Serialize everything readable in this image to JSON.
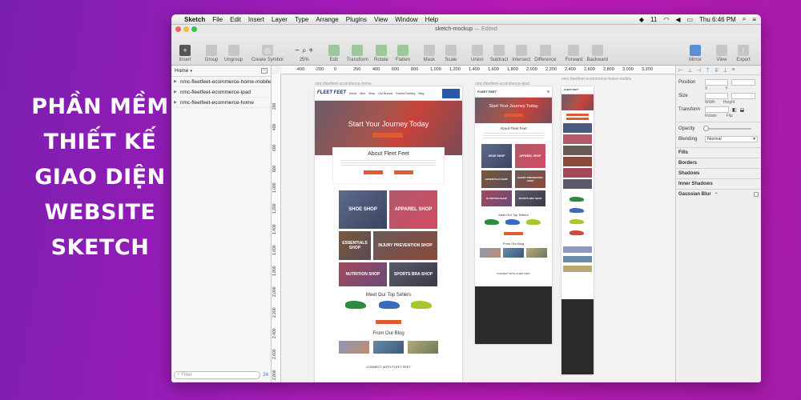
{
  "headline": [
    "PHẦN MỀM",
    "THIẾT KẾ",
    "GIAO DIỆN",
    "WEBSITE",
    "SKETCH"
  ],
  "menubar": {
    "app": "Sketch",
    "items": [
      "File",
      "Edit",
      "Insert",
      "Layer",
      "Type",
      "Arrange",
      "Plugins",
      "View",
      "Window",
      "Help"
    ],
    "status_count": "11",
    "clock": "Thu 6:46 PM"
  },
  "window": {
    "doc_title": "sketch-mockup",
    "edited": "— Edited"
  },
  "toolbar": {
    "left": [
      "Insert",
      "Group",
      "Ungroup",
      "Create Symbol"
    ],
    "zoom": "25%",
    "middle": [
      "Edit",
      "Transform",
      "Rotate",
      "Flatten",
      "Mask",
      "Scale",
      "Union",
      "Subtract",
      "Intersect",
      "Difference",
      "Forward",
      "Backward",
      "Mirror"
    ],
    "right": [
      "View",
      "Export"
    ]
  },
  "layers": {
    "page": "Home",
    "items": [
      "nmc-fleetfeet-ecommerce-home-mobile",
      "nmc-fleetfeet-ecommerce-ipad",
      "nmc-fleetfeet-ecommerce-home"
    ],
    "filter_placeholder": "Filter",
    "count": "24"
  },
  "ruler": {
    "h": [
      "-400",
      "-200",
      "0",
      "200",
      "400",
      "600",
      "800",
      "1,000",
      "1,200",
      "1,400",
      "1,600",
      "1,800",
      "2,000",
      "2,200",
      "2,400",
      "2,600",
      "2,800",
      "3,000",
      "3,200"
    ],
    "v": [
      "200",
      "400",
      "600",
      "800",
      "1,000",
      "1,200",
      "1,400",
      "1,600",
      "1,800",
      "2,000",
      "2,200",
      "2,400",
      "2,600",
      "2,800"
    ]
  },
  "artboards": {
    "desktop": {
      "label": "nmc-fleetfeet-ecommerce-home",
      "logo": "FLEET FEET",
      "nav": [
        "Home",
        "Men",
        "Shop",
        "Our Brands",
        "Events/Training",
        "Blog"
      ],
      "hero_title": "Start Your Journey Today",
      "about": "About Fleet Feet",
      "tiles": [
        "SHOE SHOP",
        "APPAREL SHOP",
        "ESSENTIALS SHOP",
        "INJURY PREVENTION SHOP",
        "NUTRITION SHOP",
        "SPORTS BRA SHOP"
      ],
      "top_sellers": "Meet Our Top Sellers",
      "from_blog": "From Our Blog",
      "connect": "CONNECT WITH FLEET FEET"
    },
    "ipad": {
      "label": "nmc-fleetfeet-ecommerce-ipad",
      "hero_title": "Start Your Journey Today",
      "about": "About Fleet Feet",
      "tiles": [
        "SHOE SHOP",
        "APPAREL SHOP",
        "ESSENTIALS SHOP",
        "INJURY PREVENTION SHOP",
        "NUTRITION SHOP",
        "SPORTS BRA SHOP"
      ],
      "top_sellers": "Meet Our Top Sellers",
      "from_blog": "From Our Blog",
      "connect": "CONNECT WITH FLEET FEET"
    },
    "mobile": {
      "label": "nmc-fleetfeet-ecommerce-home-mobile"
    }
  },
  "inspector": {
    "position": "Position",
    "x": "X",
    "y": "Y",
    "size": "Size",
    "width": "Width",
    "height": "Height",
    "transform": "Transform",
    "rotate": "Rotate",
    "flip": "Flip",
    "opacity": "Opacity",
    "blending": "Blending",
    "blend_value": "Normal",
    "sections": [
      "Fills",
      "Borders",
      "Shadows",
      "Inner Shadows",
      "Gaussian Blur"
    ]
  },
  "colors": {
    "accent": "#e05a33",
    "brand_navy": "#1e2b5e",
    "bg_purple": "#a01bb8"
  }
}
